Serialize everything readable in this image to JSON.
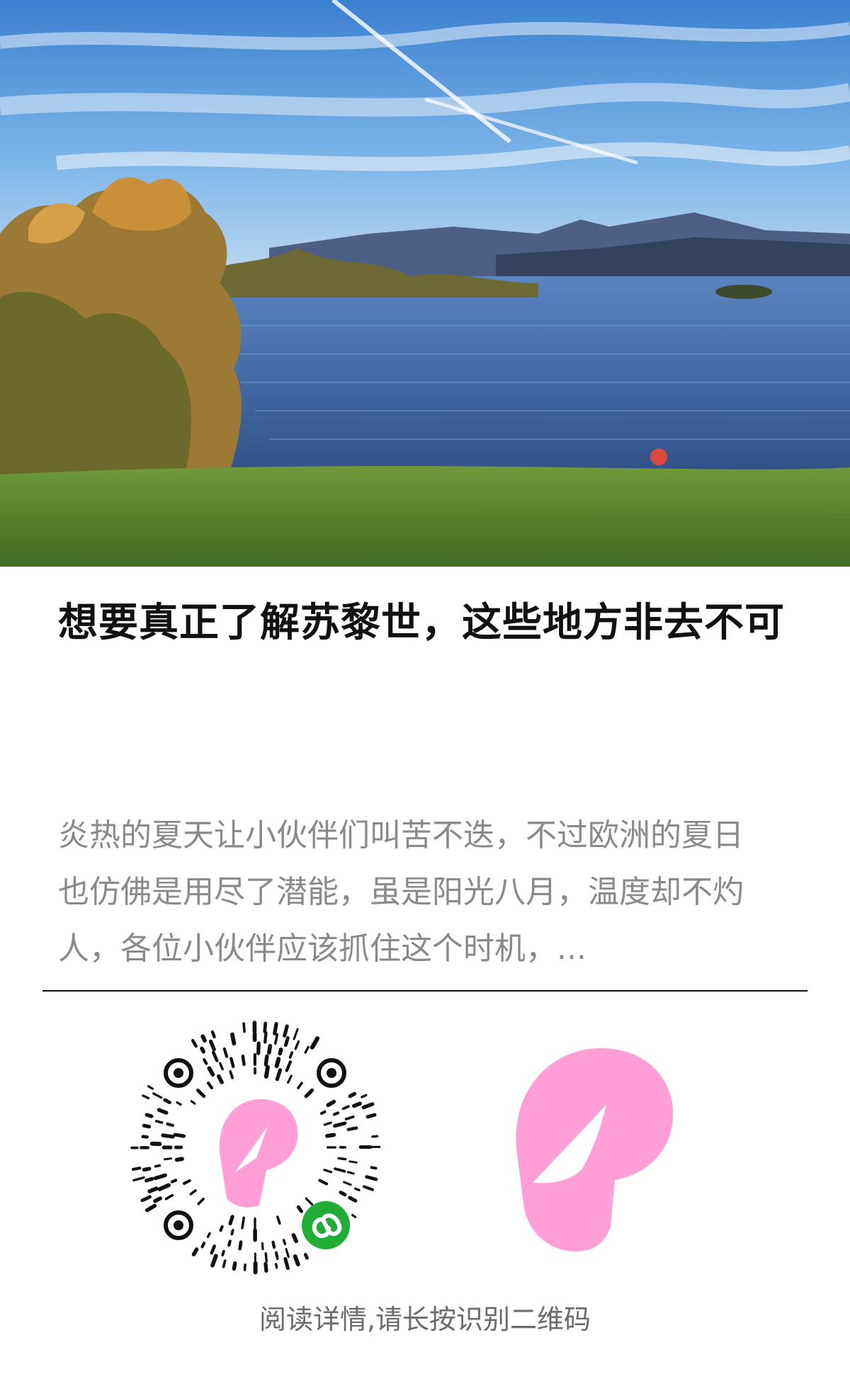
{
  "article": {
    "title": "想要真正了解苏黎世，这些地方非去不可",
    "summary": "炎热的夏天让小伙伴们叫苦不迭，不过欧洲的夏日也仿佛是用尽了潜能，虽是阳光八月，温度却不灼人，各位小伙伴应该抓住这个时机，..."
  },
  "footer": {
    "hint": "阅读详情,请长按识别二维码"
  },
  "colors": {
    "brand_pink": "#ff9fd5",
    "miniprogram_green": "#22ac38",
    "title_text": "#111111",
    "summary_text": "#8a8a8a"
  }
}
